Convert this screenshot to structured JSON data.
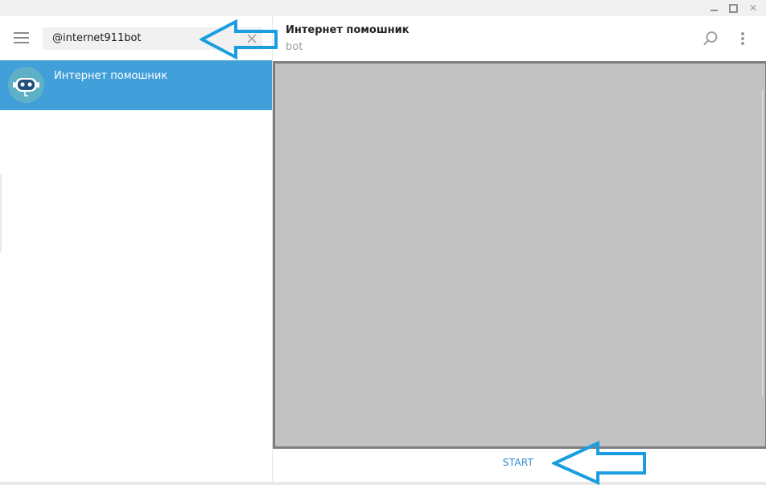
{
  "window": {
    "controls": {
      "minimize_icon": "minimize-icon",
      "maximize_icon": "maximize-icon",
      "close_glyph": "✕"
    }
  },
  "sidebar": {
    "menu_icon": "hamburger-menu-icon",
    "search": {
      "value": "@internet911bot",
      "clear_icon": "close-icon"
    },
    "results": [
      {
        "name": "Интернет помошник",
        "avatar_icon": "robot-avatar-icon",
        "selected": true
      }
    ]
  },
  "chat": {
    "peer_name": "Интернет помошник",
    "peer_status": "bot",
    "search_icon": "search-icon",
    "more_icon": "more-vertical-icon"
  },
  "composer": {
    "start_label": "START"
  },
  "annotations": {
    "arrow_color": "#1a9ee0"
  },
  "colors": {
    "selected_item": "#419fd9",
    "start_text": "#2f8cc8",
    "chat_placeholder": "#c2c2c2"
  }
}
